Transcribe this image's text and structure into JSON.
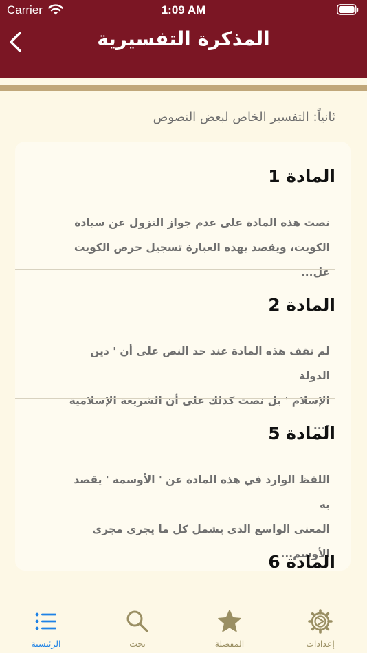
{
  "status_bar": {
    "carrier": "Carrier",
    "time": "1:09 AM"
  },
  "header": {
    "title": "المذكرة التفسيرية"
  },
  "section": {
    "heading": "ثانياً: التفسير الخاص لبعض النصوص"
  },
  "articles": [
    {
      "title": "المادة 1",
      "line1": "نصت هذه المادة على عدم جواز النزول عن سيادة",
      "line2": "الكويت، ويقصد بهذه العبارة تسجيل حرص الكويت عل..."
    },
    {
      "title": "المادة 2",
      "line1": "لم تقف هذه المادة عند حد النص على أن ' دين الدولة",
      "line2": "الإسلام ' بل نصت كذلك على أن الشريعة الإسلامية -..."
    },
    {
      "title": "المادة 5",
      "line1": "اللفظ الوارد في هذه المادة عن ' الأوسمة ' يقصد به",
      "line2": "المعنى الواسع الذي يشمل كل ما يجري مجرى الأوسم..."
    },
    {
      "title": "المادة 6"
    }
  ],
  "tabs": [
    {
      "label": "الرئيسية",
      "icon": "list-icon",
      "active": true
    },
    {
      "label": "بحث",
      "icon": "search-icon"
    },
    {
      "label": "المفضلة",
      "icon": "star-icon"
    },
    {
      "label": "إعدادات",
      "icon": "gear-icon"
    }
  ],
  "colors": {
    "header": "#7b1624",
    "gold": "#c0a77a",
    "background": "#fdf8e6",
    "active_tab": "#1e82e6",
    "inactive_tab": "#9a8f63"
  }
}
